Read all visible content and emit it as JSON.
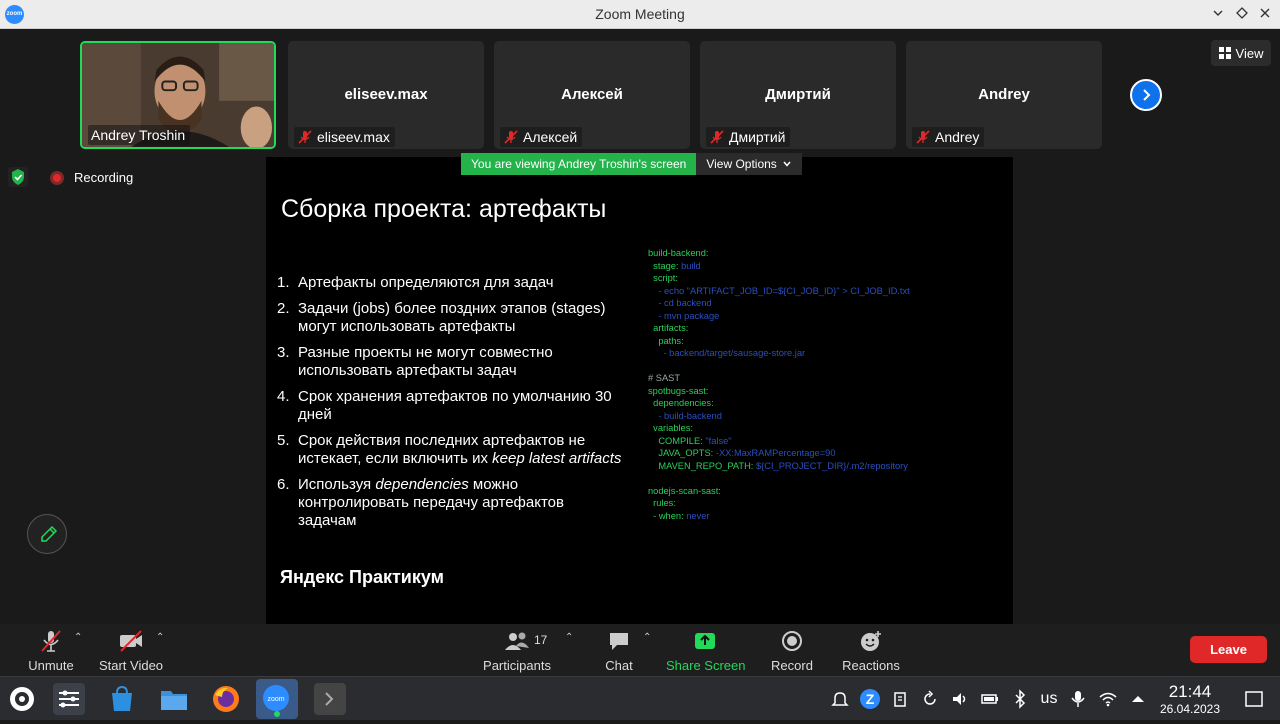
{
  "window": {
    "title": "Zoom Meeting",
    "app_icon_text": "zoom"
  },
  "participants_strip": [
    {
      "name": "Andrey Troshin",
      "active": true
    },
    {
      "name": "eliseev.max",
      "center": "eliseev.max",
      "muted": true
    },
    {
      "name": "Алексей",
      "center": "Алексей",
      "muted": true
    },
    {
      "name": "Дмиртий",
      "center": "Дмиртий",
      "muted": true
    },
    {
      "name": "Andrey",
      "center": "Andrey",
      "muted": true
    }
  ],
  "view_button": "View",
  "recording_label": "Recording",
  "share_banner": {
    "text": "You are viewing Andrey Troshin's screen",
    "options": "View Options"
  },
  "slide": {
    "title": "Сборка проекта: артефакты",
    "items": [
      {
        "num": "1.",
        "html": "Артефакты определяются для задач"
      },
      {
        "num": "2.",
        "html": "Задачи (jobs) более поздних этапов (stages) могут использовать артефакты"
      },
      {
        "num": "3.",
        "html": "Разные проекты не могут совместно использовать артефакты задач"
      },
      {
        "num": "4.",
        "html": "Срок хранения артефактов по умолчанию 30 дней"
      },
      {
        "num": "5.",
        "html": "Срок действия последних артефактов не истекает, если включить их <i>keep latest artifacts</i>"
      },
      {
        "num": "6.",
        "html": "Используя <i>dependencies</i> можно контролировать передачу артефактов задачам"
      }
    ],
    "brand": "Яндекс Практикум",
    "code_lines": [
      [
        [
          "k",
          "build-backend:"
        ]
      ],
      [
        [
          "k",
          "  stage: "
        ],
        [
          "v",
          "build"
        ]
      ],
      [
        [
          "k",
          "  script:"
        ]
      ],
      [
        [
          "v",
          "    - echo \"ARTIFACT_JOB_ID=${CI_JOB_ID}\" > CI_JOB_ID.txt"
        ]
      ],
      [
        [
          "v",
          "    - cd backend"
        ]
      ],
      [
        [
          "v",
          "    - mvn package"
        ]
      ],
      [
        [
          "k",
          "  artifacts:"
        ]
      ],
      [
        [
          "k",
          "    paths:"
        ]
      ],
      [
        [
          "v",
          "      - backend/target/sausage-store.jar"
        ]
      ],
      [
        [
          "c",
          " "
        ]
      ],
      [
        [
          "c",
          "# SAST"
        ]
      ],
      [
        [
          "k",
          "spotbugs-sast:"
        ]
      ],
      [
        [
          "k",
          "  dependencies:"
        ]
      ],
      [
        [
          "v",
          "    - build-backend"
        ]
      ],
      [
        [
          "k",
          "  variables:"
        ]
      ],
      [
        [
          "k",
          "    COMPILE: "
        ],
        [
          "v",
          "\"false\""
        ]
      ],
      [
        [
          "k",
          "    JAVA_OPTS: "
        ],
        [
          "v",
          "-XX:MaxRAMPercentage=90"
        ]
      ],
      [
        [
          "k",
          "    MAVEN_REPO_PATH: "
        ],
        [
          "v",
          "${CI_PROJECT_DIR}/.m2/repository"
        ]
      ],
      [
        [
          "c",
          " "
        ]
      ],
      [
        [
          "k",
          "nodejs-scan-sast:"
        ]
      ],
      [
        [
          "k",
          "  rules:"
        ]
      ],
      [
        [
          "k",
          "  - when: "
        ],
        [
          "v",
          "never"
        ]
      ]
    ]
  },
  "controls": {
    "unmute": "Unmute",
    "start_video": "Start Video",
    "participants": "Participants",
    "participants_count": "17",
    "chat": "Chat",
    "share_screen": "Share Screen",
    "record": "Record",
    "reactions": "Reactions",
    "leave": "Leave"
  },
  "taskbar": {
    "keyboard_layout": "us",
    "time": "21:44",
    "date": "26.04.2023"
  },
  "colors": {
    "accent_green": "#23d959",
    "leave_red": "#e02828",
    "zoom_blue": "#0e72ed"
  }
}
